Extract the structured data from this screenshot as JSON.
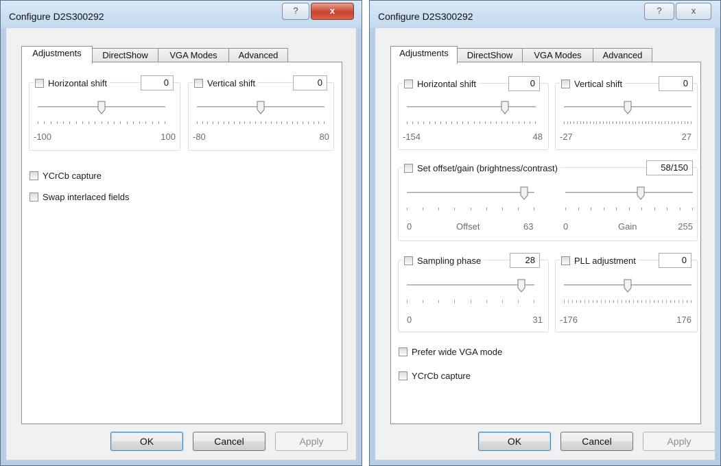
{
  "left": {
    "title": "Configure D2S300292",
    "help_glyph": "?",
    "close_glyph": "x",
    "tabs": [
      "Adjustments",
      "DirectShow",
      "VGA Modes",
      "Advanced"
    ],
    "horizontal": {
      "label": "Horizontal shift",
      "value": "0",
      "min": "-100",
      "max": "100",
      "fraction": 0.5
    },
    "vertical": {
      "label": "Vertical shift",
      "value": "0",
      "min": "-80",
      "max": "80",
      "fraction": 0.5
    },
    "ycrcb": "YCrCb capture",
    "swap": "Swap interlaced fields",
    "ok": "OK",
    "cancel": "Cancel",
    "apply": "Apply"
  },
  "right": {
    "title": "Configure D2S300292",
    "help_glyph": "?",
    "close_glyph": "x",
    "tabs": [
      "Adjustments",
      "DirectShow",
      "VGA Modes",
      "Advanced"
    ],
    "horizontal": {
      "label": "Horizontal shift",
      "value": "0",
      "min": "-154",
      "max": "48",
      "fraction": 0.76
    },
    "vertical": {
      "label": "Vertical shift",
      "value": "0",
      "min": "-27",
      "max": "27",
      "fraction": 0.5
    },
    "offset_gain": {
      "label": "Set offset/gain (brightness/contrast)",
      "value": "58/150",
      "offset_min": "0",
      "offset_caption": "Offset",
      "offset_max": "63",
      "offset_fraction": 0.92,
      "gain_min": "0",
      "gain_caption": "Gain",
      "gain_max": "255",
      "gain_fraction": 0.59
    },
    "sampling": {
      "label": "Sampling phase",
      "value": "28",
      "min": "0",
      "max": "31",
      "fraction": 0.9
    },
    "pll": {
      "label": "PLL adjustment",
      "value": "0",
      "min": "-176",
      "max": "176",
      "fraction": 0.5
    },
    "prefer_wide": "Prefer wide VGA mode",
    "ycrcb": "YCrCb capture",
    "ok": "OK",
    "cancel": "Cancel",
    "apply": "Apply"
  }
}
